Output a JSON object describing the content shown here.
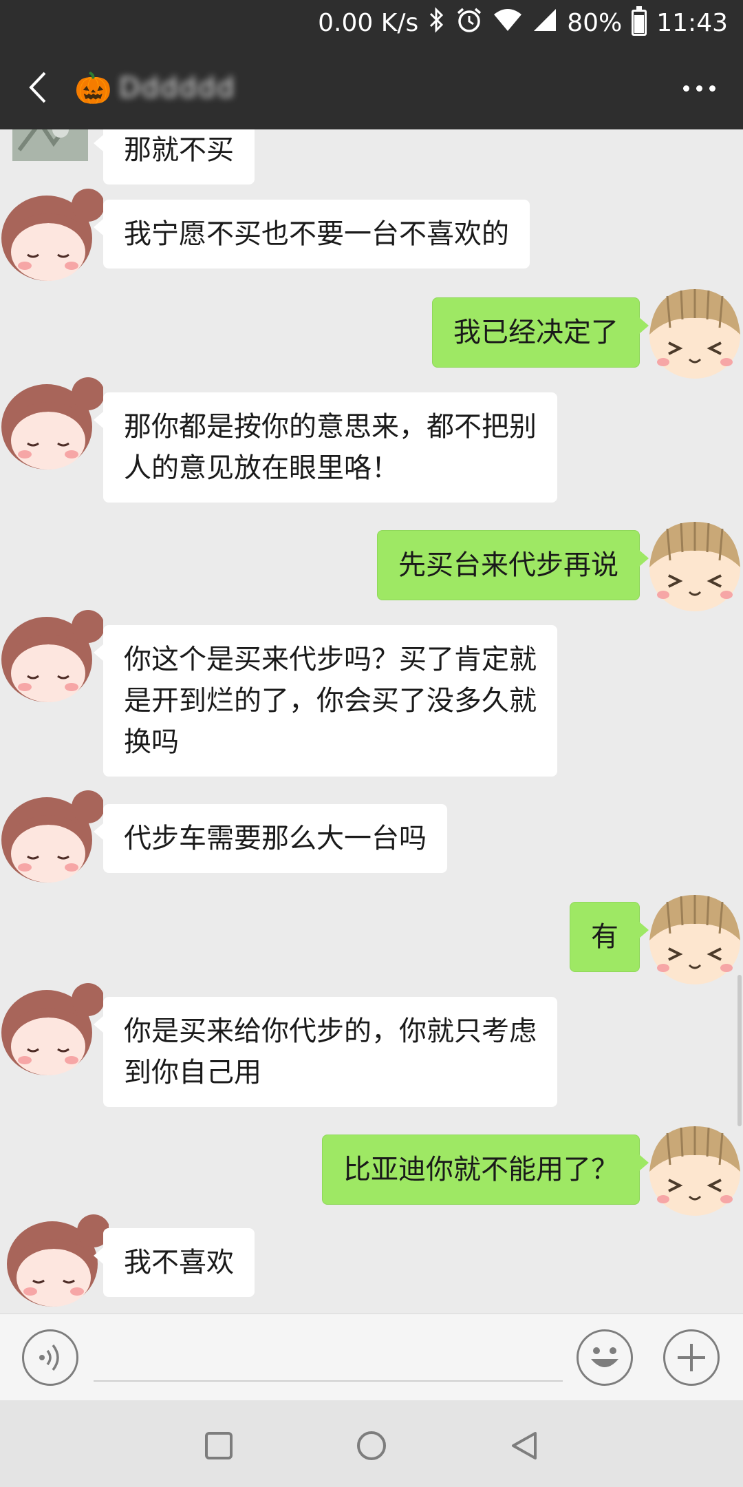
{
  "status_bar": {
    "net_speed": "0.00 K/s",
    "battery": "80%",
    "battery_level": 0.8,
    "time": "11:43",
    "icons": [
      "bluetooth-icon",
      "alarm-icon",
      "wifi-icon",
      "signal-icon",
      "battery-icon"
    ]
  },
  "header": {
    "back_icon": "chevron-left-icon",
    "contact_name": "Dddddd",
    "contact_emoji": "🎃",
    "more_icon": "more-dots-icon"
  },
  "messages": [
    {
      "side": "left",
      "text": "那就不买",
      "avatar": "photo"
    },
    {
      "side": "left",
      "text": "我宁愿不买也不要一台不喜欢的",
      "avatar": "girl"
    },
    {
      "side": "right",
      "text": "我已经决定了",
      "avatar": "boy"
    },
    {
      "side": "left",
      "lines": [
        "那你都是按你的意思来，都不把别",
        "人的意见放在眼里咯！"
      ],
      "avatar": "girl"
    },
    {
      "side": "right",
      "text": "先买台来代步再说",
      "avatar": "boy"
    },
    {
      "side": "left",
      "lines": [
        "你这个是买来代步吗？买了肯定就",
        "是开到烂的了，你会买了没多久就",
        "换吗"
      ],
      "avatar": "girl"
    },
    {
      "side": "left",
      "text": "代步车需要那么大一台吗",
      "avatar": "girl"
    },
    {
      "side": "right",
      "text": "有",
      "avatar": "boy"
    },
    {
      "side": "left",
      "lines": [
        "你是买来给你代步的，你就只考虑",
        "到你自己用"
      ],
      "avatar": "girl"
    },
    {
      "side": "right",
      "text": "比亚迪你就不能用了？",
      "avatar": "boy"
    },
    {
      "side": "left",
      "text": "我不喜欢",
      "avatar": "girl"
    }
  ],
  "input_bar": {
    "voice_icon": "voice-icon",
    "input_value": "",
    "emoji_icon": "emoji-icon",
    "plus_icon": "plus-icon"
  },
  "nav_bar": {
    "icons": [
      "recent-apps-icon",
      "home-icon",
      "back-icon"
    ]
  },
  "colors": {
    "header_bg": "#2e2e2e",
    "chat_bg": "#ebebeb",
    "bubble_left": "#ffffff",
    "bubble_right": "#9ee864",
    "girl_hair": "#a8655a",
    "boy_hair": "#c9a877"
  }
}
